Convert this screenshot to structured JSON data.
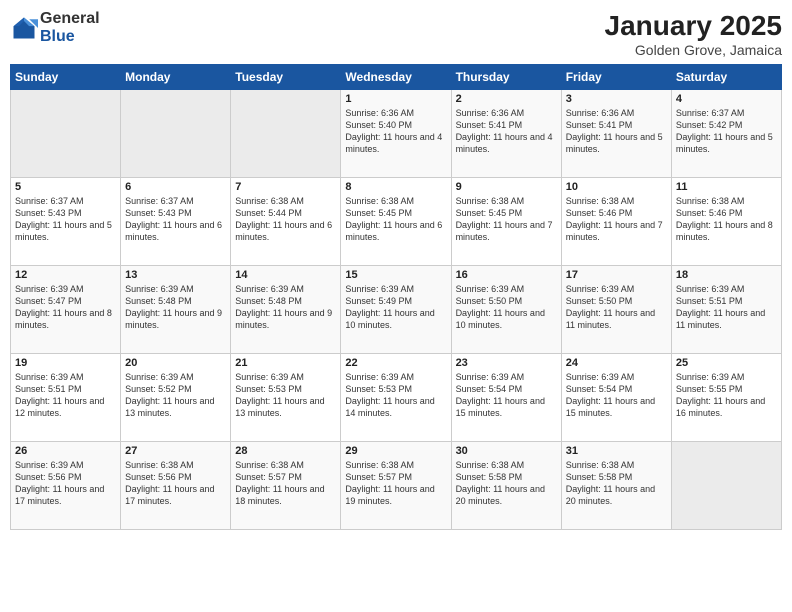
{
  "logo": {
    "general": "General",
    "blue": "Blue"
  },
  "title": "January 2025",
  "subtitle": "Golden Grove, Jamaica",
  "days_of_week": [
    "Sunday",
    "Monday",
    "Tuesday",
    "Wednesday",
    "Thursday",
    "Friday",
    "Saturday"
  ],
  "weeks": [
    [
      {
        "day": "",
        "sunrise": "",
        "sunset": "",
        "daylight": ""
      },
      {
        "day": "",
        "sunrise": "",
        "sunset": "",
        "daylight": ""
      },
      {
        "day": "",
        "sunrise": "",
        "sunset": "",
        "daylight": ""
      },
      {
        "day": "1",
        "sunrise": "Sunrise: 6:36 AM",
        "sunset": "Sunset: 5:40 PM",
        "daylight": "Daylight: 11 hours and 4 minutes."
      },
      {
        "day": "2",
        "sunrise": "Sunrise: 6:36 AM",
        "sunset": "Sunset: 5:41 PM",
        "daylight": "Daylight: 11 hours and 4 minutes."
      },
      {
        "day": "3",
        "sunrise": "Sunrise: 6:36 AM",
        "sunset": "Sunset: 5:41 PM",
        "daylight": "Daylight: 11 hours and 5 minutes."
      },
      {
        "day": "4",
        "sunrise": "Sunrise: 6:37 AM",
        "sunset": "Sunset: 5:42 PM",
        "daylight": "Daylight: 11 hours and 5 minutes."
      }
    ],
    [
      {
        "day": "5",
        "sunrise": "Sunrise: 6:37 AM",
        "sunset": "Sunset: 5:43 PM",
        "daylight": "Daylight: 11 hours and 5 minutes."
      },
      {
        "day": "6",
        "sunrise": "Sunrise: 6:37 AM",
        "sunset": "Sunset: 5:43 PM",
        "daylight": "Daylight: 11 hours and 6 minutes."
      },
      {
        "day": "7",
        "sunrise": "Sunrise: 6:38 AM",
        "sunset": "Sunset: 5:44 PM",
        "daylight": "Daylight: 11 hours and 6 minutes."
      },
      {
        "day": "8",
        "sunrise": "Sunrise: 6:38 AM",
        "sunset": "Sunset: 5:45 PM",
        "daylight": "Daylight: 11 hours and 6 minutes."
      },
      {
        "day": "9",
        "sunrise": "Sunrise: 6:38 AM",
        "sunset": "Sunset: 5:45 PM",
        "daylight": "Daylight: 11 hours and 7 minutes."
      },
      {
        "day": "10",
        "sunrise": "Sunrise: 6:38 AM",
        "sunset": "Sunset: 5:46 PM",
        "daylight": "Daylight: 11 hours and 7 minutes."
      },
      {
        "day": "11",
        "sunrise": "Sunrise: 6:38 AM",
        "sunset": "Sunset: 5:46 PM",
        "daylight": "Daylight: 11 hours and 8 minutes."
      }
    ],
    [
      {
        "day": "12",
        "sunrise": "Sunrise: 6:39 AM",
        "sunset": "Sunset: 5:47 PM",
        "daylight": "Daylight: 11 hours and 8 minutes."
      },
      {
        "day": "13",
        "sunrise": "Sunrise: 6:39 AM",
        "sunset": "Sunset: 5:48 PM",
        "daylight": "Daylight: 11 hours and 9 minutes."
      },
      {
        "day": "14",
        "sunrise": "Sunrise: 6:39 AM",
        "sunset": "Sunset: 5:48 PM",
        "daylight": "Daylight: 11 hours and 9 minutes."
      },
      {
        "day": "15",
        "sunrise": "Sunrise: 6:39 AM",
        "sunset": "Sunset: 5:49 PM",
        "daylight": "Daylight: 11 hours and 10 minutes."
      },
      {
        "day": "16",
        "sunrise": "Sunrise: 6:39 AM",
        "sunset": "Sunset: 5:50 PM",
        "daylight": "Daylight: 11 hours and 10 minutes."
      },
      {
        "day": "17",
        "sunrise": "Sunrise: 6:39 AM",
        "sunset": "Sunset: 5:50 PM",
        "daylight": "Daylight: 11 hours and 11 minutes."
      },
      {
        "day": "18",
        "sunrise": "Sunrise: 6:39 AM",
        "sunset": "Sunset: 5:51 PM",
        "daylight": "Daylight: 11 hours and 11 minutes."
      }
    ],
    [
      {
        "day": "19",
        "sunrise": "Sunrise: 6:39 AM",
        "sunset": "Sunset: 5:51 PM",
        "daylight": "Daylight: 11 hours and 12 minutes."
      },
      {
        "day": "20",
        "sunrise": "Sunrise: 6:39 AM",
        "sunset": "Sunset: 5:52 PM",
        "daylight": "Daylight: 11 hours and 13 minutes."
      },
      {
        "day": "21",
        "sunrise": "Sunrise: 6:39 AM",
        "sunset": "Sunset: 5:53 PM",
        "daylight": "Daylight: 11 hours and 13 minutes."
      },
      {
        "day": "22",
        "sunrise": "Sunrise: 6:39 AM",
        "sunset": "Sunset: 5:53 PM",
        "daylight": "Daylight: 11 hours and 14 minutes."
      },
      {
        "day": "23",
        "sunrise": "Sunrise: 6:39 AM",
        "sunset": "Sunset: 5:54 PM",
        "daylight": "Daylight: 11 hours and 15 minutes."
      },
      {
        "day": "24",
        "sunrise": "Sunrise: 6:39 AM",
        "sunset": "Sunset: 5:54 PM",
        "daylight": "Daylight: 11 hours and 15 minutes."
      },
      {
        "day": "25",
        "sunrise": "Sunrise: 6:39 AM",
        "sunset": "Sunset: 5:55 PM",
        "daylight": "Daylight: 11 hours and 16 minutes."
      }
    ],
    [
      {
        "day": "26",
        "sunrise": "Sunrise: 6:39 AM",
        "sunset": "Sunset: 5:56 PM",
        "daylight": "Daylight: 11 hours and 17 minutes."
      },
      {
        "day": "27",
        "sunrise": "Sunrise: 6:38 AM",
        "sunset": "Sunset: 5:56 PM",
        "daylight": "Daylight: 11 hours and 17 minutes."
      },
      {
        "day": "28",
        "sunrise": "Sunrise: 6:38 AM",
        "sunset": "Sunset: 5:57 PM",
        "daylight": "Daylight: 11 hours and 18 minutes."
      },
      {
        "day": "29",
        "sunrise": "Sunrise: 6:38 AM",
        "sunset": "Sunset: 5:57 PM",
        "daylight": "Daylight: 11 hours and 19 minutes."
      },
      {
        "day": "30",
        "sunrise": "Sunrise: 6:38 AM",
        "sunset": "Sunset: 5:58 PM",
        "daylight": "Daylight: 11 hours and 20 minutes."
      },
      {
        "day": "31",
        "sunrise": "Sunrise: 6:38 AM",
        "sunset": "Sunset: 5:58 PM",
        "daylight": "Daylight: 11 hours and 20 minutes."
      },
      {
        "day": "",
        "sunrise": "",
        "sunset": "",
        "daylight": ""
      }
    ]
  ]
}
